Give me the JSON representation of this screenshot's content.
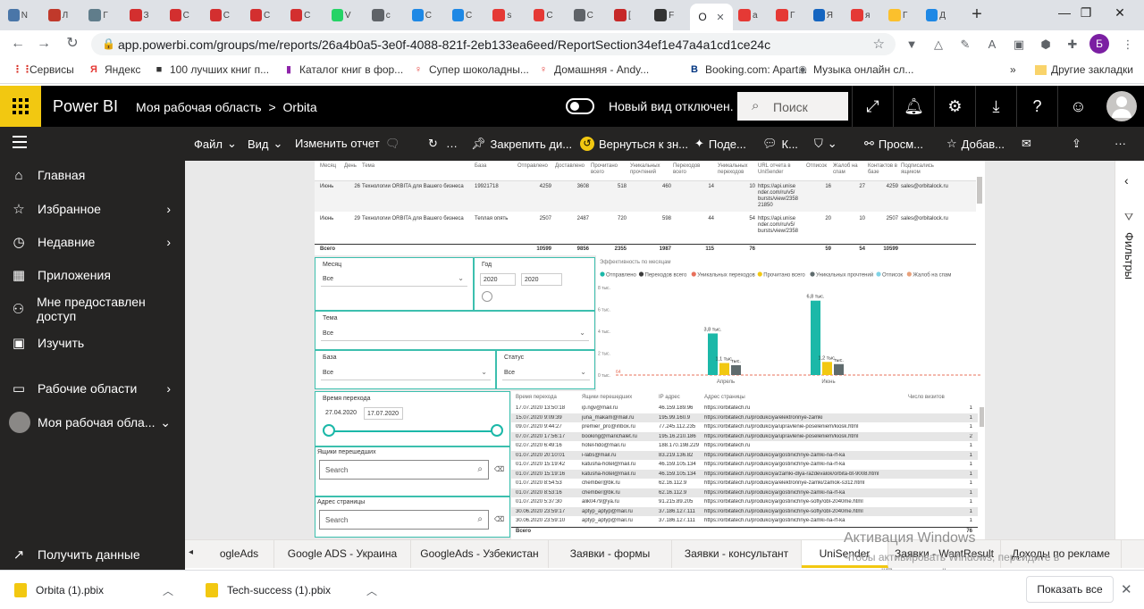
{
  "browser": {
    "tabs": [
      {
        "letter": "N",
        "color": "#4a76a8"
      },
      {
        "letter": "Л",
        "color": "#c0392b"
      },
      {
        "letter": "Г",
        "color": "#607d8b"
      },
      {
        "letter": "З",
        "color": "#d32f2f"
      },
      {
        "letter": "С",
        "color": "#d32f2f"
      },
      {
        "letter": "С",
        "color": "#d32f2f"
      },
      {
        "letter": "С",
        "color": "#d32f2f"
      },
      {
        "letter": "С",
        "color": "#d32f2f"
      },
      {
        "letter": "V",
        "color": "#25d366"
      },
      {
        "letter": "с",
        "color": "#5f6368"
      },
      {
        "letter": "С",
        "color": "#1e88e5"
      },
      {
        "letter": "С",
        "color": "#1e88e5"
      },
      {
        "letter": "s",
        "color": "#e53935"
      },
      {
        "letter": "С",
        "color": "#e53935"
      },
      {
        "letter": "С",
        "color": "#5f6368"
      },
      {
        "letter": "[",
        "color": "#c62828"
      },
      {
        "letter": "F",
        "color": "#333333"
      }
    ],
    "active_tab_label": "О",
    "tabs_right": [
      {
        "letter": "а",
        "color": "#e53935"
      },
      {
        "letter": "Г",
        "color": "#e53935"
      },
      {
        "letter": "Я",
        "color": "#1565c0"
      },
      {
        "letter": "я",
        "color": "#e53935"
      },
      {
        "letter": "Г",
        "color": "#fbc02d"
      },
      {
        "letter": "Д",
        "color": "#1e88e5"
      }
    ],
    "new_tab": "+",
    "url": "app.powerbi.com/groups/me/reports/26a4b0a5-3e0f-4088-821f-2eb133ea6eed/ReportSection34ef1e47a4a1cd1ce24c",
    "profile_letter": "Б",
    "bookmarks": [
      {
        "label": "Сервисы",
        "icon": "⋮⋮",
        "color": "#d93025"
      },
      {
        "label": "Яндекс",
        "icon": "Я",
        "color": "#e53935"
      },
      {
        "label": "100 лучших книг п...",
        "icon": "■",
        "color": "#333333"
      },
      {
        "label": "Каталог книг в фор...",
        "icon": "▮",
        "color": "#8e24aa"
      },
      {
        "label": "Супер шоколадны...",
        "icon": "♀",
        "color": "#e53935"
      },
      {
        "label": "Домашняя - Andy...",
        "icon": "♀",
        "color": "#e53935"
      },
      {
        "label": "Booking.com: Apart...",
        "icon": "B",
        "color": "#003580"
      },
      {
        "label": "Музыка онлайн сл...",
        "icon": "◉",
        "color": "#5f6368"
      }
    ],
    "bookmarks_more": "»",
    "other_bookmarks": "Другие закладки"
  },
  "pbi": {
    "brand": "Power BI",
    "breadcrumb_workspace": "Моя рабочая область",
    "breadcrumb_sep": ">",
    "breadcrumb_report": "Orbita",
    "new_view": "Новый вид отключен.",
    "search_placeholder": "Поиск"
  },
  "leftnav": {
    "items": [
      {
        "label": "Главная",
        "icon": "⌂",
        "chevron": false
      },
      {
        "label": "Избранное",
        "icon": "☆",
        "chevron": true
      },
      {
        "label": "Недавние",
        "icon": "◷",
        "chevron": true
      },
      {
        "label": "Приложения",
        "icon": "▦",
        "chevron": false
      },
      {
        "label": "Мне предоставлен доступ",
        "icon": "⚇",
        "chevron": false
      },
      {
        "label": "Изучить",
        "icon": "▣",
        "chevron": false
      },
      {
        "label": "Рабочие области",
        "icon": "▭",
        "chevron": true
      },
      {
        "label": "Моя рабочая обла...",
        "icon": "●",
        "chevron": true
      }
    ],
    "get_data": "Получить данные"
  },
  "toolbar": {
    "items": [
      "Файл",
      "Вид",
      "Изменить отчет",
      "",
      "…",
      "Закрепить ди...",
      "Вернуться к зн...",
      "Поде...",
      "К...",
      "",
      "Просм...",
      "Добав...",
      "",
      "",
      ""
    ]
  },
  "filters_label": "Фильтры",
  "top_table": {
    "headers": [
      "Месяц",
      "День",
      "Тема",
      "База",
      "Отправлено",
      "Доставлено",
      "Прочитано всего",
      "Уникальных прочтений",
      "Переходов всего",
      "Уникальных переходов",
      "URL отчета в UniSender",
      "Отписок",
      "Жалоб на спам",
      "Контактов в базе",
      "Подписались ящиком"
    ],
    "rows": [
      [
        "Июнь",
        "26",
        "Технологии ORBITA для Вашего бизнеса",
        "19921718",
        "4259",
        "3608",
        "518",
        "460",
        "14",
        "10",
        "https://api.unise nder.com/ru/v5/ bursts/view/2358 21850",
        "16",
        "27",
        "4259",
        "sales@orbitalock.ru"
      ],
      [
        "Июнь",
        "29",
        "Технологии ORBITA для Вашего бизнеса",
        "Теплая опять",
        "2507",
        "2487",
        "720",
        "598",
        "44",
        "54",
        "https://api.unise nder.com/ru/v5/ bursts/view/2358",
        "20",
        "10",
        "2507",
        "sales@orbitalock.ru"
      ]
    ],
    "total": [
      "Всего",
      "",
      "",
      "",
      "10599",
      "9856",
      "2355",
      "1987",
      "115",
      "76",
      "",
      "59",
      "54",
      "10599",
      ""
    ]
  },
  "filters": {
    "month_label": "Месяц",
    "month_value": "Все",
    "year_label": "Год",
    "year_from": "2020",
    "year_to": "2020",
    "theme_label": "Тема",
    "theme_value": "Все",
    "base_label": "База",
    "base_value": "Все",
    "status_label": "Статус",
    "status_value": "Все",
    "time_label": "Время перехода",
    "date_from": "27.04.2020",
    "date_to": "17.07.2020",
    "mailbox_label": "Ящики перешедших",
    "mailbox_search": "Search",
    "page_label": "Адрес страницы",
    "page_search": "Search"
  },
  "chart_data": {
    "type": "bar",
    "title": "Эффективность по месяцам",
    "categories": [
      "Апрель",
      "Июнь"
    ],
    "series": [
      {
        "name": "Отправлено",
        "color": "#1bb8a8",
        "values": [
          3.8,
          6.8
        ],
        "labels": [
          "3,8 тыс.",
          "6,8 тыс."
        ]
      },
      {
        "name": "Переходов всего",
        "color": "#3b3b3b",
        "values": [
          0,
          0
        ],
        "labels": [
          "",
          ""
        ]
      },
      {
        "name": "Уникальных переходов",
        "color": "#e8705b",
        "values": [
          0,
          0
        ],
        "labels": [
          "",
          ""
        ]
      },
      {
        "name": "Прочитано всего",
        "color": "#f2c811",
        "values": [
          1.1,
          1.2
        ],
        "labels": [
          "1,1 тыс.",
          "1,2 тыс."
        ]
      },
      {
        "name": "Уникальных прочтений",
        "color": "#5f6b6d",
        "values": [
          0.9,
          1.0
        ],
        "labels": [
          "тыс.",
          "тыс."
        ]
      },
      {
        "name": "Отписок",
        "color": "#7fd3e6",
        "values": [
          0,
          0
        ],
        "labels": [
          "",
          ""
        ]
      },
      {
        "name": "Жалоб на спам",
        "color": "#e8a07a",
        "values": [
          0,
          0
        ],
        "labels": [
          "",
          ""
        ]
      }
    ],
    "extra_labels": [
      "0,9 тыс.",
      "1 тыс."
    ],
    "yticks": [
      "8 тыс.",
      "6 тыс.",
      "4 тыс.",
      "2 тыс.",
      "0 тыс."
    ],
    "ylim": [
      0,
      8
    ],
    "target_label": "64"
  },
  "bottom_table": {
    "headers": [
      "Время перехода",
      "Ящики перешедших",
      "IP адрес",
      "Адрес страницы",
      "Число визитов"
    ],
    "rows": [
      [
        "17.07.2020 13:50:18",
        "ip.ngv@mail.ru",
        "46.159.189.96",
        "https://orbitatech.ru",
        "1"
      ],
      [
        "15.07.2020 9:09:39",
        "juna_makam@mail.ru",
        "195.99.160.9",
        "https://orbitatech.ru/produkciya/elektronnye-zamki",
        "1"
      ],
      [
        "09.07.2020 9:44:27",
        "premier_pro@inbox.ru",
        "77.245.112.235",
        "https://orbitatech.ru/produkciya/upravlenie-poseleniem/kiosk.html",
        "1"
      ],
      [
        "07.07.2020 17:56:17",
        "booking@marichalet.ru",
        "195.16.210.186",
        "https://orbitatech.ru/produkciya/upravlenie-poseleniem/kiosk.html",
        "2"
      ],
      [
        "02.07.2020 6:49:16",
        "hotel-fido@mail.ru",
        "188.170.198.229",
        "https://orbitatech.ru",
        "1"
      ],
      [
        "01.07.2020 20:10:01",
        "i-labs@mail.ru",
        "83.219.136.82",
        "https://orbitatech.ru/produkciya/gostinichnye-zamki-na-rf-ka",
        "1"
      ],
      [
        "01.07.2020 15:19:42",
        "katusha-hotel@mail.ru",
        "46.159.105.134",
        "https://orbitatech.ru/produkciya/gostinichnye-zamki-na-rf-ka",
        "1"
      ],
      [
        "01.07.2020 15:19:16",
        "katusha-hotel@mail.ru",
        "46.159.105.134",
        "https://orbitatech.ru/produkciya/zamki-dlya-razdevalok/orbita-bt-9008.html",
        "1"
      ],
      [
        "01.07.2020 8:54:53",
        "chember@bk.ru",
        "62.16.112.9",
        "https://orbitatech.ru/produkciya/elektronnye-zamki/zamok-s31z.html",
        "1"
      ],
      [
        "01.07.2020 8:53:16",
        "chember@bk.ru",
        "62.16.112.9",
        "https://orbitatech.ru/produkciya/gostinichnye-zamki-na-rf-ka",
        "1"
      ],
      [
        "01.07.2020 5:37:30",
        "alik0479@ya.ru",
        "91.215.89.205",
        "https://orbitatech.ru/produkciya/gostinichnye-sofly/obl-2040me.html",
        "1"
      ],
      [
        "30.06.2020 23:59:17",
        "aptyp_aptyp@mail.ru",
        "37.186.127.111",
        "https://orbitatech.ru/produkciya/gostinichnye-sofly/obl-2040me.html",
        "1"
      ],
      [
        "30.06.2020 23:59:10",
        "aptyp_aptyp@mail.ru",
        "37.186.127.111",
        "https://orbitatech.ru/produkciya/gostinichnye-zamki-na-rf-ka",
        "1"
      ]
    ],
    "total_label": "Всего",
    "total_value": "76"
  },
  "page_tabs": [
    "ogleAds",
    "Google ADS - Украина",
    "GoogleAds - Узбекистан",
    "Заявки - формы",
    "Заявки - консультант",
    "UniSender",
    "Заявки - WantResult",
    "Доходы по рекламе"
  ],
  "active_page": "UniSender",
  "watermark": {
    "title": "Активация Windows",
    "line1": "Чтобы активировать Windows, перейдите в",
    "line2": "раздел \"Параметры\"."
  },
  "downloads": {
    "items": [
      "Orbita (1).pbix",
      "Tech-success (1).pbix"
    ],
    "show_all": "Показать все"
  }
}
